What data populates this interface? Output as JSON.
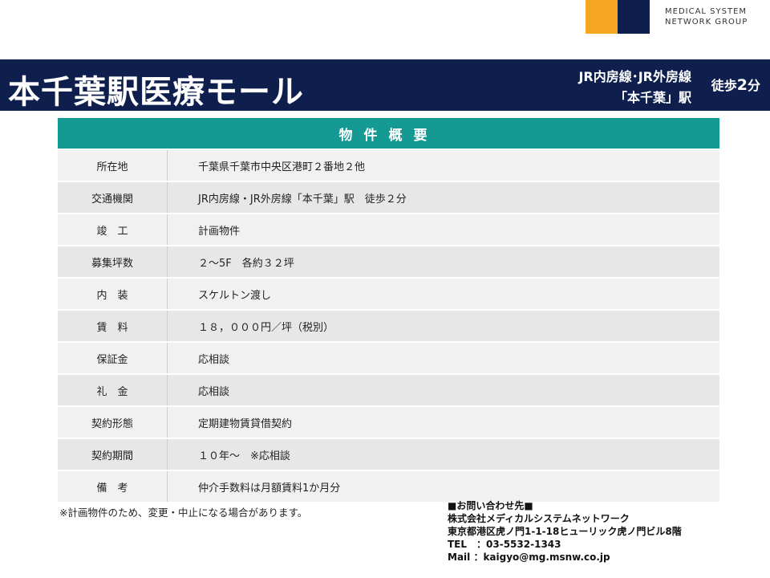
{
  "logo": {
    "line1": "MEDICAL SYSTEM",
    "line2": "NETWORK GROUP",
    "colors": {
      "orange": "#f5a623",
      "navy": "#0e1f4e"
    }
  },
  "header": {
    "title": "本千葉駅医療モール",
    "line_1": "JR内房線･JR外房線",
    "line_2": "「本千葉」駅",
    "walk_prefix": "徒歩",
    "walk_minutes": "2",
    "walk_suffix": "分",
    "background": "#0e1f4e"
  },
  "table": {
    "heading": "物件概要",
    "heading_color": "#159a93",
    "rows": [
      {
        "label": "所在地",
        "value": "千葉県千葉市中央区港町２番地２他"
      },
      {
        "label": "交通機関",
        "value": "JR内房線・JR外房線「本千葉」駅　徒歩２分"
      },
      {
        "label": "竣　工",
        "value": "計画物件"
      },
      {
        "label": "募集坪数",
        "value": "２～5F　各約３２坪"
      },
      {
        "label": "内　装",
        "value": "スケルトン渡し"
      },
      {
        "label": "賃　料",
        "value": "１８，０００円／坪（税別）"
      },
      {
        "label": "保証金",
        "value": "応相談"
      },
      {
        "label": "礼　金",
        "value": "応相談"
      },
      {
        "label": "契約形態",
        "value": "定期建物賃貸借契約"
      },
      {
        "label": "契約期間",
        "value": "１０年～　※応相談"
      },
      {
        "label": "備　考",
        "value": "仲介手数料は月額賃料1か月分"
      }
    ]
  },
  "note": "※計画物件のため、変更・中止になる場合があります。",
  "contact": {
    "heading": "■お問い合わせ先■",
    "company": "株式会社メディカルシステムネットワーク",
    "address": "東京都港区虎ノ門1-1-18ヒューリック虎ノ門ビル8階",
    "tel": "TEL　：03-5532-1343",
    "mail": "Mail ：kaigyo@mg.msnw.co.jp"
  }
}
